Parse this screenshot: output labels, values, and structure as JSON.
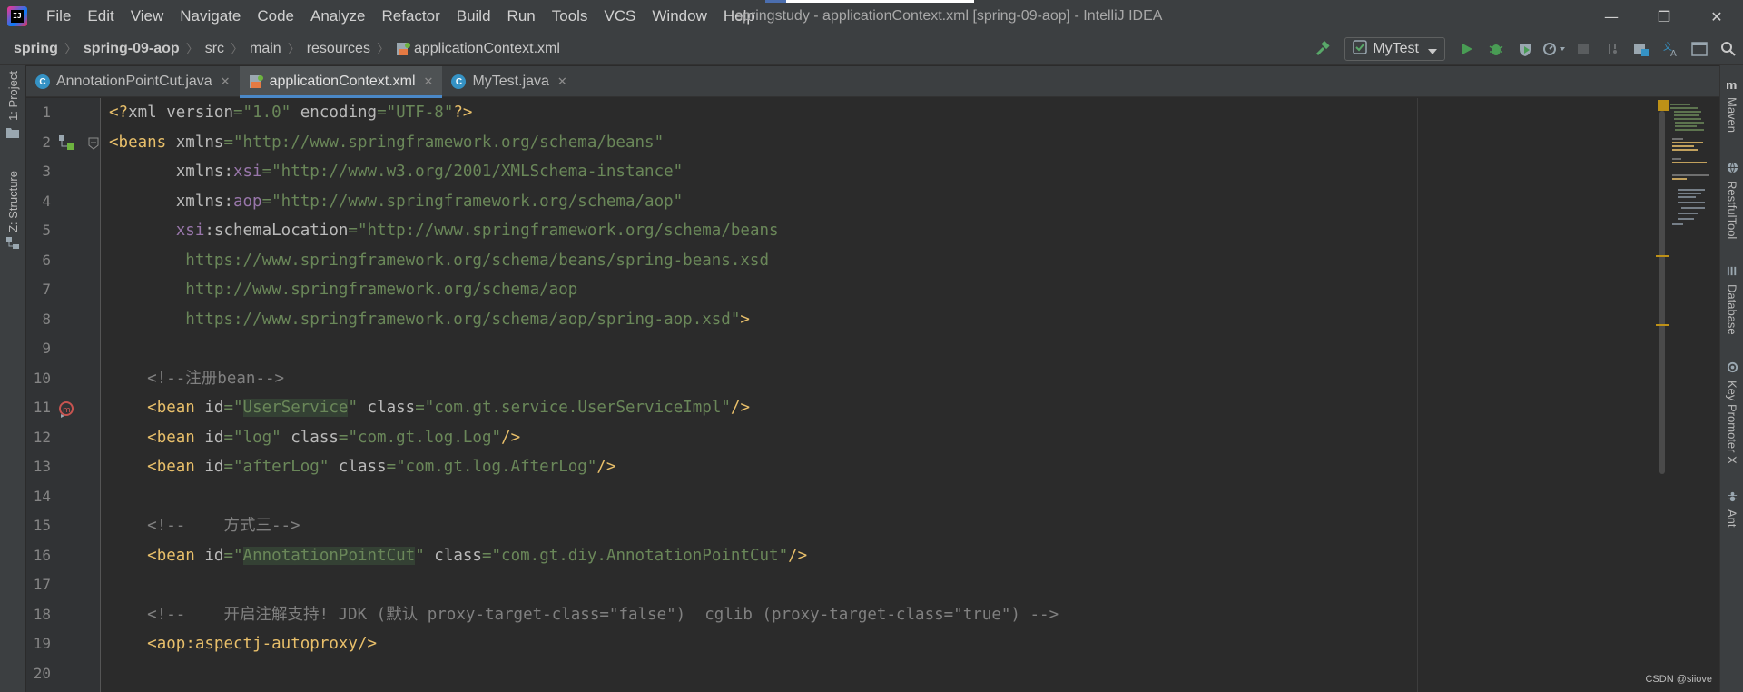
{
  "window": {
    "title": "springstudy - applicationContext.xml [spring-09-aop] - IntelliJ IDEA",
    "menu": [
      "File",
      "Edit",
      "View",
      "Navigate",
      "Code",
      "Analyze",
      "Refactor",
      "Build",
      "Run",
      "Tools",
      "VCS",
      "Window",
      "Help"
    ],
    "controls": {
      "minimize": "—",
      "restore": "❐",
      "close": "✕"
    }
  },
  "breadcrumb": [
    "spring",
    "spring-09-aop",
    "src",
    "main",
    "resources",
    "applicationContext.xml"
  ],
  "toolbar": {
    "run_config": "MyTest",
    "icons": [
      "hammer-icon",
      "run-icon",
      "debug-icon",
      "coverage-icon",
      "profile-icon",
      "stop-icon",
      "vcs-icon",
      "project-structure-icon",
      "translate-icon",
      "terminal-icon",
      "search-icon"
    ]
  },
  "left_tool_windows": [
    "1: Project",
    "Z: Structure"
  ],
  "right_tool_windows": [
    "Maven",
    "RestfulTool",
    "Database",
    "Key Promoter X",
    "Ant"
  ],
  "tabs": [
    {
      "label": "AnnotationPointCut.java",
      "icon": "java-class-icon",
      "active": false
    },
    {
      "label": "applicationContext.xml",
      "icon": "spring-xml-icon",
      "active": true
    },
    {
      "label": "MyTest.java",
      "icon": "java-test-class-icon",
      "active": false
    }
  ],
  "line_numbers": [
    "1",
    "2",
    "3",
    "4",
    "5",
    "6",
    "7",
    "8",
    "9",
    "10",
    "11",
    "12",
    "13",
    "14",
    "15",
    "16",
    "17",
    "18",
    "19",
    "20"
  ],
  "code": {
    "l1": {
      "a": "<?",
      "b": "xml ",
      "c": "version",
      "d": "=",
      "e": "\"1.0\"",
      "f": " encoding",
      "g": "=",
      "h": "\"UTF-8\"",
      "i": "?>"
    },
    "l2": {
      "a": "<beans ",
      "b": "xmlns",
      "c": "=",
      "d": "\"http://www.springframework.org/schema/beans\""
    },
    "l3": {
      "indent": "       ",
      "a": "xmlns:",
      "b": "xsi",
      "c": "=",
      "d": "\"http://www.w3.org/2001/XMLSchema-instance\""
    },
    "l4": {
      "indent": "       ",
      "a": "xmlns:",
      "b": "aop",
      "c": "=",
      "d": "\"http://www.springframework.org/schema/aop\""
    },
    "l5": {
      "indent": "       ",
      "a": "xsi",
      "b": ":schemaLocation",
      "c": "=",
      "d": "\"http://www.springframework.org/schema/beans"
    },
    "l6": {
      "indent": "        ",
      "a": "https://www.springframework.org/schema/beans/spring-beans.xsd"
    },
    "l7": {
      "indent": "        ",
      "a": "http://www.springframework.org/schema/aop"
    },
    "l8": {
      "indent": "        ",
      "a": "https://www.springframework.org/schema/aop/spring-aop.xsd\"",
      "b": ">"
    },
    "l10": {
      "indent": "    ",
      "a": "<!--注册bean-->"
    },
    "l11": {
      "indent": "    ",
      "a": "<bean ",
      "b": "id",
      "c": "=",
      "d": "\"",
      "e": "UserService",
      "f": "\"",
      "g": " class",
      "h": "=",
      "i": "\"com.gt.service.UserServiceImpl\"",
      "j": "/>"
    },
    "l12": {
      "indent": "    ",
      "a": "<bean ",
      "b": "id",
      "c": "=",
      "d": "\"log\"",
      "e": " class",
      "f": "=",
      "g": "\"com.gt.log.Log\"",
      "h": "/>"
    },
    "l13": {
      "indent": "    ",
      "a": "<bean ",
      "b": "id",
      "c": "=",
      "d": "\"afterLog\"",
      "e": " class",
      "f": "=",
      "g": "\"com.gt.log.AfterLog\"",
      "h": "/>"
    },
    "l15": {
      "indent": "    ",
      "a": "<!--    方式三-->"
    },
    "l16": {
      "indent": "    ",
      "a": "<bean ",
      "b": "id",
      "c": "=",
      "d": "\"",
      "e": "AnnotationPointCut",
      "f": "\"",
      "g": " class",
      "h": "=",
      "i": "\"com.gt.diy.AnnotationPointCut\"",
      "j": "/>"
    },
    "l18": {
      "indent": "    ",
      "a": "<!--    开启注解支持! JDK (默认 proxy-target-class=\"false\")  cglib (proxy-target-class=\"true\") -->"
    },
    "l19": {
      "indent": "    ",
      "a": "<aop",
      "b": ":aspectj-autoproxy",
      "c": "/>"
    }
  },
  "watermark": "CSDN @siiove",
  "colors": {
    "background": "#2b2b2b",
    "tag": "#e8bf6a",
    "string": "#6a8759",
    "namespace": "#9876aa",
    "comment": "#808080",
    "accent": "#4a88c7"
  }
}
